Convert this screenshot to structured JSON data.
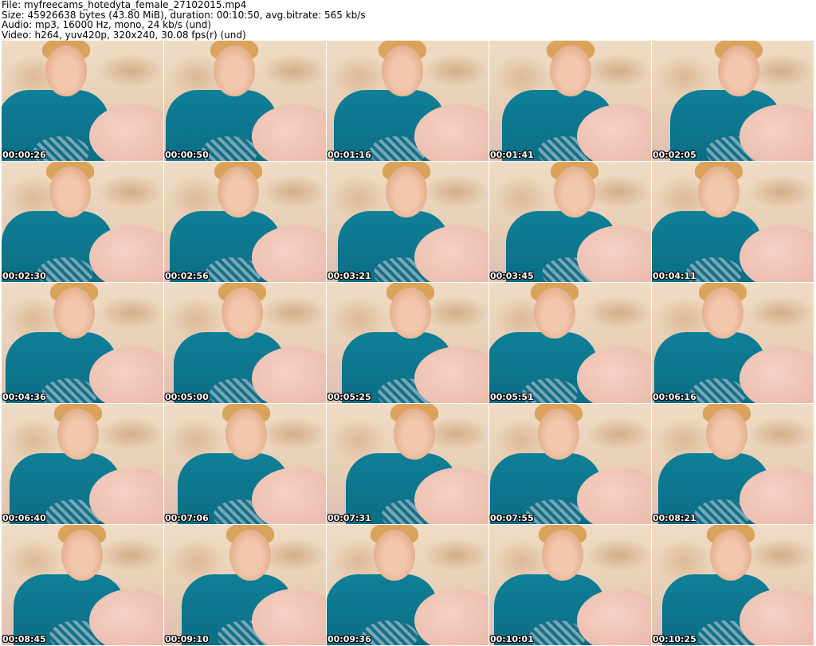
{
  "header": {
    "file": "File: myfreecams_hotedyta_female_27102015.mp4",
    "size": "Size: 45926638 bytes (43.80 MiB), duration: 00:10:50, avg.bitrate: 565 kb/s",
    "audio": "Audio: mp3, 16000 Hz, mono, 24 kb/s (und)",
    "video": "Video: h264, yuv420p, 320x240, 30.08 fps(r) (und)"
  },
  "thumbnails": [
    {
      "time": "00:00:26"
    },
    {
      "time": "00:00:50"
    },
    {
      "time": "00:01:16"
    },
    {
      "time": "00:01:41"
    },
    {
      "time": "00:02:05"
    },
    {
      "time": "00:02:30"
    },
    {
      "time": "00:02:56"
    },
    {
      "time": "00:03:21"
    },
    {
      "time": "00:03:45"
    },
    {
      "time": "00:04:11"
    },
    {
      "time": "00:04:36"
    },
    {
      "time": "00:05:00"
    },
    {
      "time": "00:05:25"
    },
    {
      "time": "00:05:51"
    },
    {
      "time": "00:06:16"
    },
    {
      "time": "00:06:40"
    },
    {
      "time": "00:07:06"
    },
    {
      "time": "00:07:31"
    },
    {
      "time": "00:07:55"
    },
    {
      "time": "00:08:21"
    },
    {
      "time": "00:08:45"
    },
    {
      "time": "00:09:10"
    },
    {
      "time": "00:09:36"
    },
    {
      "time": "00:10:01"
    },
    {
      "time": "00:10:25"
    }
  ]
}
